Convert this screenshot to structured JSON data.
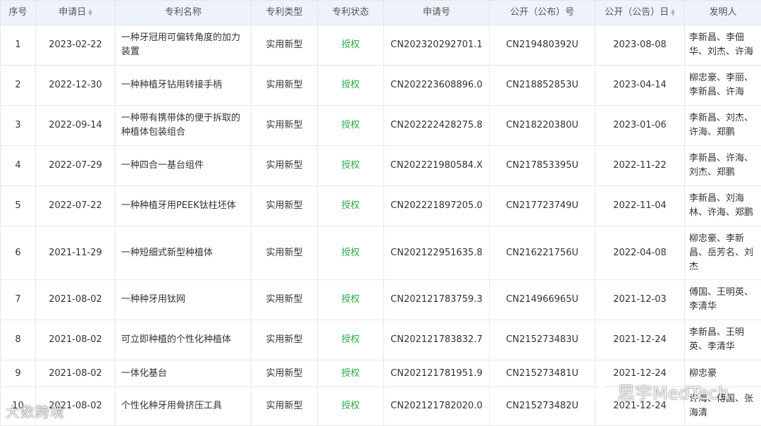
{
  "headers": {
    "index": "序号",
    "app_date": "申请日",
    "name": "专利名称",
    "type": "专利类型",
    "status": "专利状态",
    "app_no": "申请号",
    "pub_no": "公开（公布）号",
    "pub_date": "公开（公告）日",
    "inventors": "发明人"
  },
  "colors": {
    "status_green": "#2ea84a",
    "header_bg": "#eef3fb",
    "border": "#e4e7ed"
  },
  "rows": [
    {
      "index": "1",
      "app_date": "2023-02-22",
      "name": "一种牙冠用可偏转角度的加力装置",
      "type": "实用新型",
      "status": "授权",
      "app_no": "CN202320292701.1",
      "pub_no": "CN219480392U",
      "pub_date": "2023-08-08",
      "inventors": "李新昌、李佃华、刘杰、许海"
    },
    {
      "index": "2",
      "app_date": "2022-12-30",
      "name": "一种种植牙钻用转接手柄",
      "type": "实用新型",
      "status": "授权",
      "app_no": "CN202223608896.0",
      "pub_no": "CN218852853U",
      "pub_date": "2023-04-14",
      "inventors": "柳忠豪、李丽、李新昌、许海"
    },
    {
      "index": "3",
      "app_date": "2022-09-14",
      "name": "一种带有携带体的便于拆取的种植体包装组合",
      "type": "实用新型",
      "status": "授权",
      "app_no": "CN202222428275.8",
      "pub_no": "CN218220380U",
      "pub_date": "2023-01-06",
      "inventors": "李新昌、刘杰、许海、郑鹏"
    },
    {
      "index": "4",
      "app_date": "2022-07-29",
      "name": "一种四合一基台组件",
      "type": "实用新型",
      "status": "授权",
      "app_no": "CN202221980584.X",
      "pub_no": "CN217853395U",
      "pub_date": "2022-11-22",
      "inventors": "李新昌、许海、刘杰、郑鹏"
    },
    {
      "index": "5",
      "app_date": "2022-07-22",
      "name": "一种种植牙用PEEK钛柱坯体",
      "type": "实用新型",
      "status": "授权",
      "app_no": "CN202221897205.0",
      "pub_no": "CN217723749U",
      "pub_date": "2022-11-04",
      "inventors": "李新昌、刘海林、许海、郑鹏"
    },
    {
      "index": "6",
      "app_date": "2021-11-29",
      "name": "一种短细式新型种植体",
      "type": "实用新型",
      "status": "授权",
      "app_no": "CN202122951635.8",
      "pub_no": "CN216221756U",
      "pub_date": "2022-04-08",
      "inventors": "柳忠豪、李新昌、岳芳名、刘杰"
    },
    {
      "index": "7",
      "app_date": "2021-08-02",
      "name": "一种种牙用钛网",
      "type": "实用新型",
      "status": "授权",
      "app_no": "CN202121783759.3",
      "pub_no": "CN214966965U",
      "pub_date": "2021-12-03",
      "inventors": "傅国、王明英、李清华"
    },
    {
      "index": "8",
      "app_date": "2021-08-02",
      "name": "可立即种植的个性化种植体",
      "type": "实用新型",
      "status": "授权",
      "app_no": "CN202121783832.7",
      "pub_no": "CN215273483U",
      "pub_date": "2021-12-24",
      "inventors": "李新昌、王明英、李清华"
    },
    {
      "index": "9",
      "app_date": "2021-08-02",
      "name": "一体化基台",
      "type": "实用新型",
      "status": "授权",
      "app_no": "CN202121781951.9",
      "pub_no": "CN215273481U",
      "pub_date": "2021-12-24",
      "inventors": "柳忠豪"
    },
    {
      "index": "10",
      "app_date": "2021-08-02",
      "name": "个性化种牙用骨挤压工具",
      "type": "实用新型",
      "status": "授权",
      "app_no": "CN202121782020.0",
      "pub_no": "CN215273482U",
      "pub_date": "2021-12-24",
      "inventors": "许海、傅国、张海清"
    }
  ],
  "watermarks": {
    "left": "大数跨境",
    "right": "思宇MedTech"
  }
}
